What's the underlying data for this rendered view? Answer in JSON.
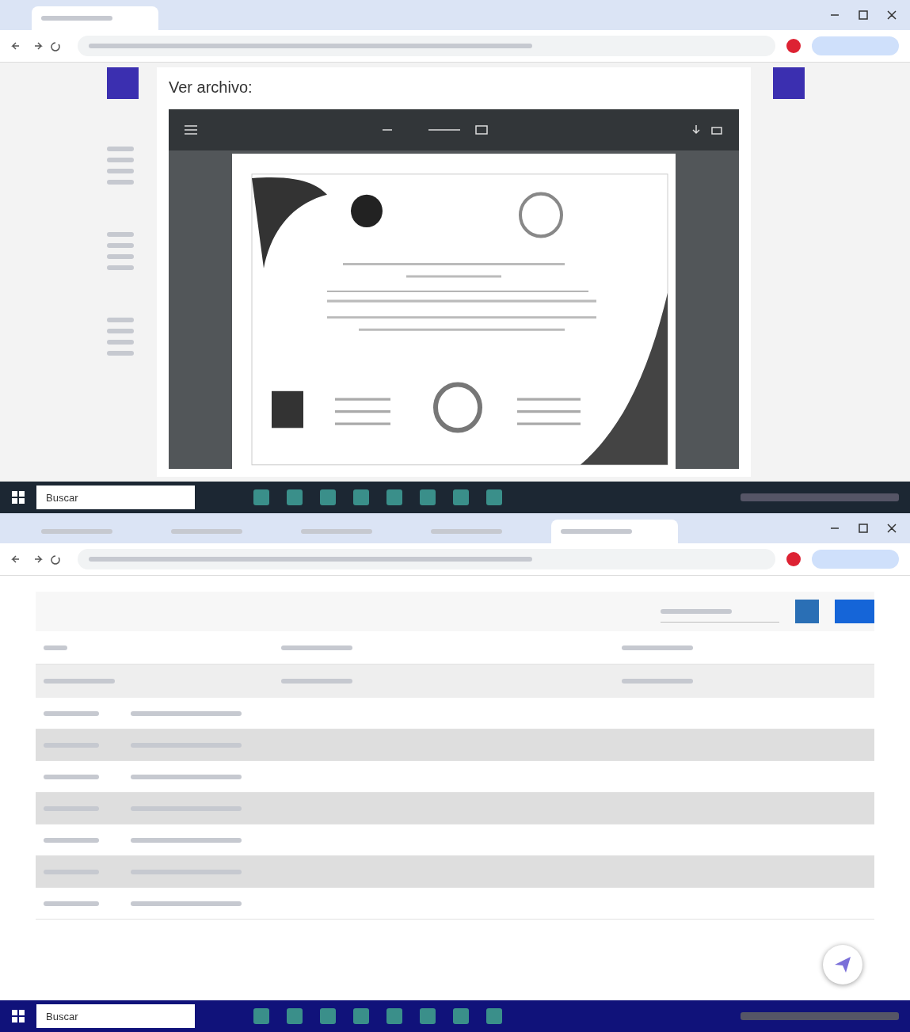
{
  "top_screen": {
    "tabs": [
      {
        "selected": true
      }
    ],
    "modal": {
      "title": "Ver archivo:"
    },
    "taskbar": {
      "search": "Buscar"
    }
  },
  "bottom_screen": {
    "tabs": [
      {
        "selected": false
      },
      {
        "selected": false
      },
      {
        "selected": false
      },
      {
        "selected": false
      },
      {
        "selected": true
      }
    ],
    "detail_rows": [
      {
        "shaded": false
      },
      {
        "shaded": true
      },
      {
        "shaded": false
      },
      {
        "shaded": true
      },
      {
        "shaded": false
      },
      {
        "shaded": true
      },
      {
        "shaded": false
      }
    ],
    "taskbar": {
      "search": "Buscar"
    }
  }
}
